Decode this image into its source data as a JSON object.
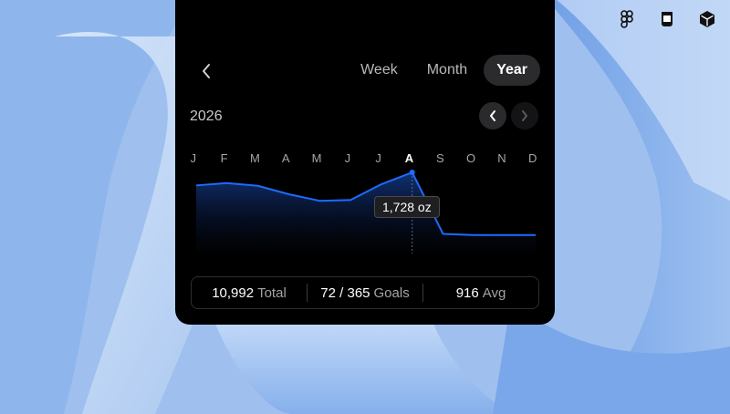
{
  "wallpaper": {
    "base": "#9fc0ee",
    "light": "#d9e7fb",
    "deep": "#6d9ee6"
  },
  "toolbar": {
    "icons": [
      "figma-icon",
      "mug-icon",
      "cube-icon"
    ]
  },
  "segmented": {
    "week": "Week",
    "month": "Month",
    "year": "Year",
    "selected": "Year"
  },
  "year": "2026",
  "months": [
    "J",
    "F",
    "M",
    "A",
    "M",
    "J",
    "J",
    "A",
    "S",
    "O",
    "N",
    "D"
  ],
  "selected_month_index": 7,
  "tooltip": "1,728 oz",
  "stats": {
    "total_value": "10,992",
    "total_label": "Total",
    "goals_value": "72 / 365",
    "goals_label": "Goals",
    "avg_value": "916",
    "avg_label": "Avg"
  },
  "chart_data": {
    "type": "area",
    "x": [
      "Jan",
      "Feb",
      "Mar",
      "Apr",
      "May",
      "Jun",
      "Jul",
      "Aug",
      "Sep",
      "Oct",
      "Nov",
      "Dec"
    ],
    "y": [
      1390,
      1450,
      1380,
      1160,
      990,
      1010,
      1420,
      1728,
      130,
      100,
      100,
      100
    ],
    "y_range": [
      0,
      1800
    ],
    "highlight_index": 7,
    "color": "#1f6bff"
  }
}
